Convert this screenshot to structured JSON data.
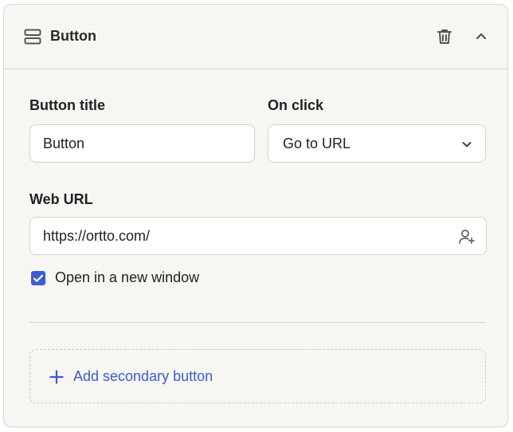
{
  "header": {
    "title": "Button",
    "icon": "layout-rows-icon",
    "actions": [
      "trash-icon",
      "chevron-up-icon"
    ]
  },
  "form": {
    "button_title": {
      "label": "Button title",
      "value": "Button"
    },
    "on_click": {
      "label": "On click",
      "selected": "Go to URL"
    },
    "web_url": {
      "label": "Web URL",
      "value": "https://ortto.com/",
      "icon": "add-person-icon"
    },
    "open_new_window": {
      "label": "Open in a new window",
      "checked": true
    }
  },
  "secondary": {
    "label": "Add secondary button"
  },
  "colors": {
    "accent": "#3b5bdb",
    "panel_bg": "#f7f6f3",
    "border": "#dcdad6"
  }
}
